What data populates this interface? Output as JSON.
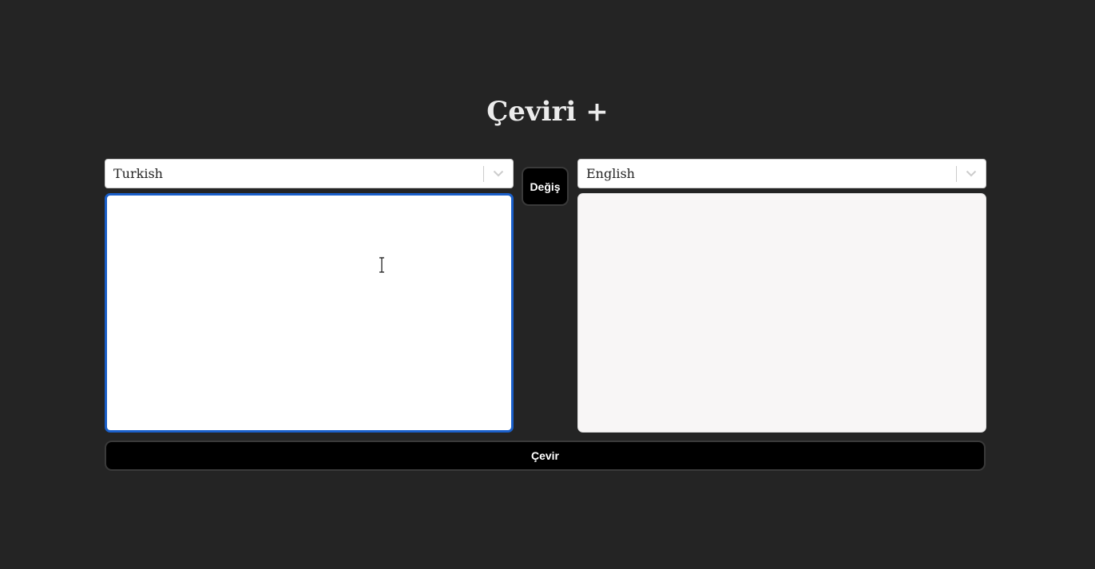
{
  "app": {
    "title": "Çeviri +"
  },
  "source_language": {
    "selected": "Turkish",
    "icon": "chevron-down-icon"
  },
  "target_language": {
    "selected": "English",
    "icon": "chevron-down-icon"
  },
  "swap_button": {
    "label": "Değiş"
  },
  "source_text": {
    "value": "",
    "placeholder": ""
  },
  "output_text": {
    "value": ""
  },
  "translate_button": {
    "label": "Çevir"
  },
  "colors": {
    "background": "#242424",
    "title": "#ececec",
    "button": "#000000",
    "focus_border": "#1a5fc9",
    "output_background": "#f8f6f6"
  }
}
